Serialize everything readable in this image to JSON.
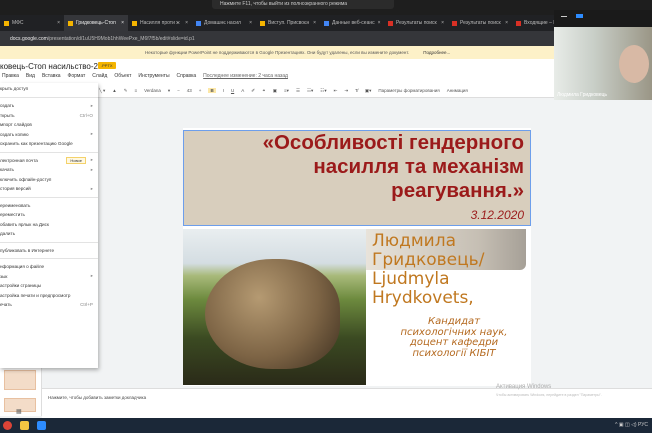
{
  "toast": "Нажмите F11, чтобы выйти из полноэкранного режима",
  "tabs": [
    {
      "label": "МФС",
      "icon": "slides"
    },
    {
      "label": "Гридковець-Стоп",
      "icon": "slides",
      "active": true
    },
    {
      "label": "Насилля проти ж",
      "icon": "slides"
    },
    {
      "label": "Домашнє насил",
      "icon": "docs"
    },
    {
      "label": "Виступ. Присвоєн",
      "icon": "slides"
    },
    {
      "label": "Данные веб-сеанс",
      "icon": "docs"
    },
    {
      "label": "Результаты поиск",
      "icon": "gmail"
    },
    {
      "label": "Результаты поиск",
      "icon": "gmail"
    },
    {
      "label": "Входящие – КВНЗ",
      "icon": "gmail"
    }
  ],
  "address": {
    "host": "docs.google.com",
    "path": "/presentation/d/1uU5H9Mob1hhWeePxe_M6f7f5b/edit#slide=id.p1"
  },
  "notice": {
    "text": "Некоторые функции PowerPoint не поддерживаются в Google Презентациях. Они будут удалены, если вы измените документ.",
    "more": "Подробнее..."
  },
  "doc": {
    "title": "ковець-Стоп насильство-20-2",
    "badge": ".PPTX"
  },
  "menu": [
    "Правка",
    "Вид",
    "Вставка",
    "Формат",
    "Слайд",
    "Объект",
    "Инструменты",
    "Справка"
  ],
  "last_edit": "Последнее изменение: 2 часа назад",
  "toolbar": {
    "font": "Verdana",
    "size": "43",
    "format_options": "Параметры форматирования",
    "animate": "Анимация"
  },
  "dropdown": {
    "share": "крыть доступ",
    "groups": [
      [
        {
          "label": "оздать",
          "arrow": true
        },
        {
          "label": "ткрыть",
          "shortcut": "Ctrl+O"
        },
        {
          "label": "мпорт слайдов"
        },
        {
          "label": "оздать копию",
          "arrow": true
        },
        {
          "label": "охранить как презентацию Google"
        }
      ],
      [
        {
          "label": "лектронная почта",
          "badge": "Новое",
          "arrow": true
        },
        {
          "label": "качать",
          "arrow": true
        },
        {
          "label": "ключить офлайн-доступ"
        },
        {
          "label": "стория версий",
          "arrow": true
        }
      ],
      [
        {
          "label": "ереименовать"
        },
        {
          "label": "ереместить"
        },
        {
          "label": "обавить ярлык на Диск"
        },
        {
          "label": "далить"
        }
      ],
      [
        {
          "label": "публиковать в Интернете"
        }
      ],
      [
        {
          "label": "нформация о файле"
        },
        {
          "label": "зык",
          "arrow": true
        },
        {
          "label": "астройки страницы"
        },
        {
          "label": "астройка печати и предпросмотр"
        },
        {
          "label": "ечать",
          "shortcut": "Ctrl+P"
        }
      ]
    ]
  },
  "slide": {
    "title": "«Особливості гендерного насилля та механізм реагування.»",
    "title_lines": [
      "«Особливості гендерного",
      "насилля та механізм",
      "реагування.»"
    ],
    "date": "3.12.2020",
    "name_lines": [
      "Людмила",
      "Гридковець/",
      "Ljudmyla",
      "Hrydkovets,"
    ],
    "role_lines": [
      "Кандидат",
      "психологічних наук,",
      "доцент кафедри",
      "психології КІБІТ"
    ]
  },
  "notes_placeholder": "Нажмите, чтобы добавить заметки докладчика",
  "windows_activation": {
    "title": "Активация Windows",
    "text": "Чтобы активировать Windows, перейдите в раздел \"Параметры\"."
  },
  "webcam": {
    "name": "Людмила Гридковець"
  },
  "tray": "^ ▣ ◫ ◁) РУС",
  "colors": {
    "title_red": "#9b1a1a",
    "name_orange": "#c07820",
    "notice_yellow": "#fdf1c8",
    "pptx_badge": "#f4b400"
  }
}
